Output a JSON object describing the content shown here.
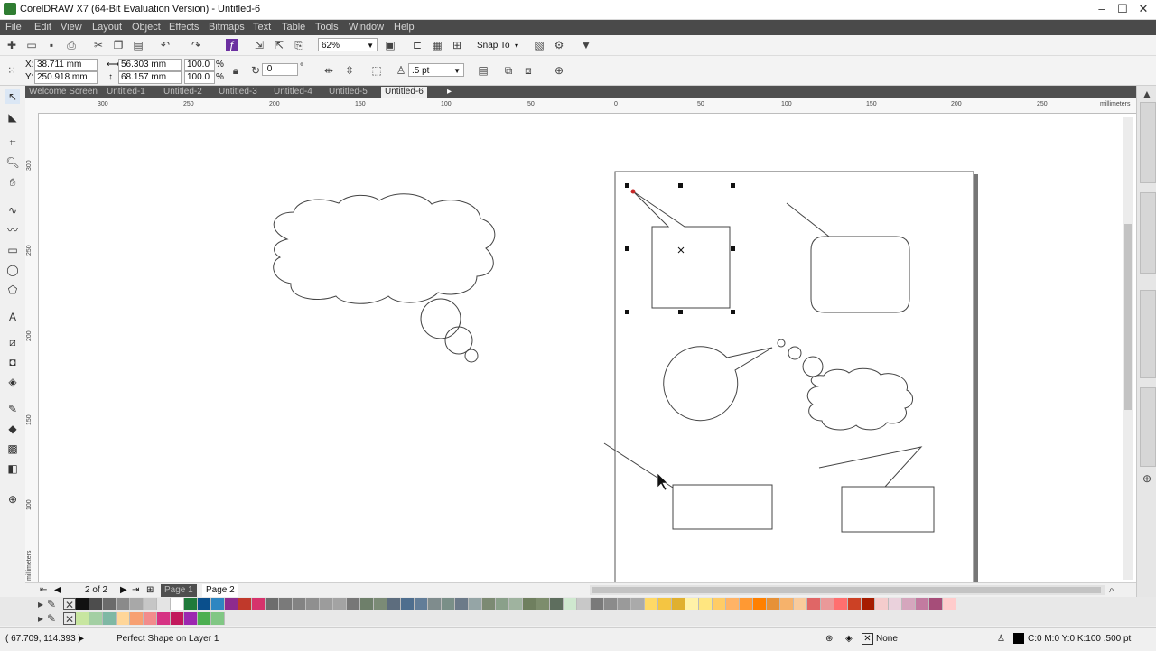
{
  "window": {
    "title": "CorelDRAW X7 (64-Bit Evaluation Version) - Untitled-6"
  },
  "menu": [
    "File",
    "Edit",
    "View",
    "Layout",
    "Object",
    "Effects",
    "Bitmaps",
    "Text",
    "Table",
    "Tools",
    "Window",
    "Help"
  ],
  "standard_toolbar": {
    "zoom": "62%",
    "snap_to": "Snap To"
  },
  "property_bar": {
    "x_label": "X:",
    "x_value": "38.711 mm",
    "y_label": "Y:",
    "y_value": "250.918 mm",
    "width": "56.303 mm",
    "height": "68.157 mm",
    "scale_w": "100.0",
    "scale_h": "100.0",
    "percent": "%",
    "rotation": ".0",
    "degree": "°",
    "outline_width": ".5 pt"
  },
  "doc_tabs": [
    "Welcome Screen",
    "Untitled-1",
    "Untitled-2",
    "Untitled-3",
    "Untitled-4",
    "Untitled-5",
    "Untitled-6"
  ],
  "active_tab": "Untitled-6",
  "hruler": {
    "labels": [
      "300",
      "250",
      "200",
      "150",
      "100",
      "50",
      "0",
      "50",
      "100",
      "150",
      "200",
      "250"
    ],
    "unit": "millimeters"
  },
  "vruler": {
    "labels": [
      "300",
      "250",
      "200",
      "150",
      "100"
    ],
    "unit": "millimeters"
  },
  "page_nav": {
    "counter": "2 of 2",
    "pages": [
      "Page 1",
      "Page 2"
    ]
  },
  "status": {
    "coords": "( 67.709, 114.393 )",
    "message": "Perfect Shape on Layer 1",
    "fill": "None",
    "outline": "C:0 M:0 Y:0 K:100  .500 pt"
  },
  "palette": {
    "row1": [
      "#111111",
      "#4d4d4d",
      "#6b6b6b",
      "#8a8a8a",
      "#a8a8a8",
      "#c6c6c6",
      "#e4e4e4",
      "#ffffff",
      "#1f7a3a",
      "#0a4f8c",
      "#2e86c1",
      "#8e2b8e",
      "#c0392b",
      "#d6336c",
      "#6d6d6d",
      "#7a7a7a",
      "#838383",
      "#8f8f8f",
      "#9c9c9c",
      "#a3a3a3",
      "#777777",
      "#6e7f6a",
      "#7b8b76",
      "#5d6d7e",
      "#4e6e8e",
      "#627d98",
      "#7f8c8d",
      "#7a8f88",
      "#6c7a89",
      "#95a5a6",
      "#7c8a73",
      "#8aa08a",
      "#9fb39f",
      "#6f7f5f",
      "#7d8d6d",
      "#5e6e5e",
      "#cfe8cf",
      "#c8c8c8",
      "#7a7a7a",
      "#8b8b8b",
      "#9a9a9a",
      "#aaaaaa",
      "#ffd966",
      "#f4c542",
      "#e0b030",
      "#fff2a8",
      "#ffe680",
      "#ffcc66",
      "#ffb366",
      "#ff9933",
      "#ff8000",
      "#e69138",
      "#f6b26b",
      "#f9cb9c",
      "#e06666",
      "#ea9999",
      "#ff6f6f",
      "#cc4125",
      "#a61c00",
      "#f4cccc",
      "#ead1dc",
      "#d5a6bd",
      "#c27ba0",
      "#a64d79",
      "#ffcccc"
    ],
    "row2": [
      "#c8e6a0",
      "#a3cfa3",
      "#7fb8a4",
      "#ffd699",
      "#f7a072",
      "#f28c8c",
      "#d63384",
      "#c2185b",
      "#9c27b0",
      "#4caf50",
      "#81c784"
    ]
  }
}
